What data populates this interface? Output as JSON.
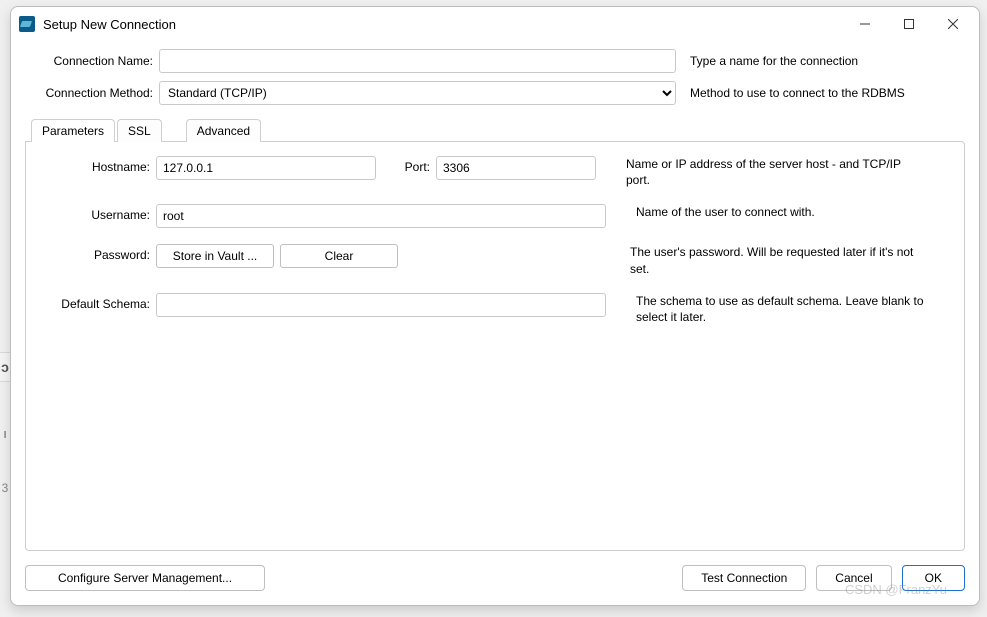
{
  "window": {
    "title": "Setup New Connection"
  },
  "top": {
    "connection_name_label": "Connection Name:",
    "connection_name_value": "",
    "connection_name_help": "Type a name for the connection",
    "connection_method_label": "Connection Method:",
    "connection_method_value": "Standard (TCP/IP)",
    "connection_method_help": "Method to use to connect to the RDBMS"
  },
  "tabs": {
    "parameters": "Parameters",
    "ssl": "SSL",
    "advanced": "Advanced"
  },
  "params": {
    "hostname_label": "Hostname:",
    "hostname_value": "127.0.0.1",
    "port_label": "Port:",
    "port_value": "3306",
    "hostname_help": "Name or IP address of the server host - and TCP/IP port.",
    "username_label": "Username:",
    "username_value": "root",
    "username_help": "Name of the user to connect with.",
    "password_label": "Password:",
    "store_in_vault": "Store in Vault ...",
    "clear": "Clear",
    "password_help": "The user's password. Will be requested later if it's not set.",
    "schema_label": "Default Schema:",
    "schema_value": "",
    "schema_help": "The schema to use as default schema. Leave blank to select it later."
  },
  "footer": {
    "configure": "Configure Server Management...",
    "test": "Test Connection",
    "cancel": "Cancel",
    "ok": "OK"
  },
  "watermark": "CSDN @FranzYu"
}
